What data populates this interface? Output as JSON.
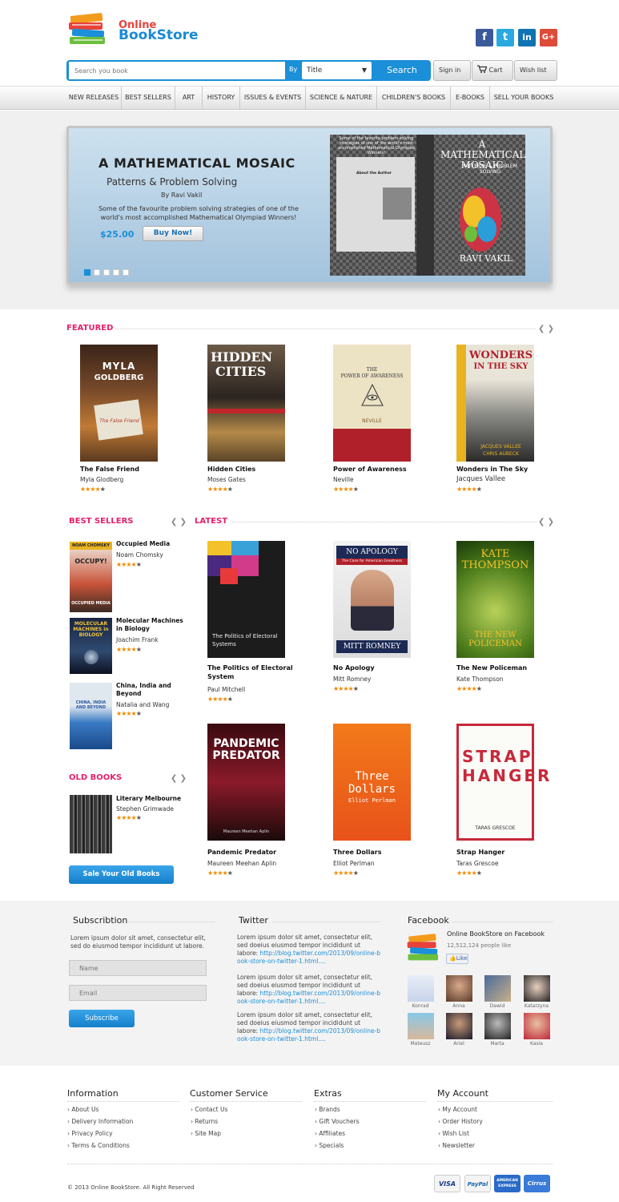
{
  "header": {
    "logo_top": "Online",
    "logo_bottom": "BookStore",
    "social": [
      "f",
      "t",
      "in",
      "G+"
    ],
    "search": {
      "placeholder": "Search you book",
      "by": "By",
      "select": "Title",
      "button": "Search"
    },
    "account": {
      "sign_in": "Sign in",
      "cart": "Cart",
      "wish_list": "Wish list"
    }
  },
  "nav": [
    "NEW RELEASES",
    "BEST SELLERS",
    "ART",
    "HISTORY",
    "ISSUES & EVENTS",
    "SCIENCE & NATURE",
    "CHILDREN'S BOOKS",
    "E-BOOKS",
    "SELL YOUR BOOKS"
  ],
  "hero": {
    "title": "A MATHEMATICAL MOSAIC",
    "subtitle": "Patterns & Problem Solving",
    "by": "By Ravi Vakil",
    "desc": "Some of the favourite problem solving strategies of one of the world's most accomplished Mathematical Olympiad Winners!",
    "price": "$25.00",
    "button": "Buy Now!",
    "cover_title": "A MATHEMATICAL MOSAIC",
    "cover_sub": "PATTERNS & PROBLEM SOLVING",
    "cover_author": "RAVI VAKIL",
    "cover_back": "Some of the favorite problem solving strategies of one of the world's most accomplished Mathematical Olympiad Winners!",
    "cover_about": "About the Author"
  },
  "featured": {
    "title": "FEATURED",
    "books": [
      {
        "title": "The False Friend",
        "author": "Myla Glodberg",
        "rating": 4,
        "cover_top": "MYLA",
        "cover_mid": "GOLDBERG",
        "cover_note": "The False Friend"
      },
      {
        "title": "Hidden Cities",
        "author": "Moses Gates",
        "rating": 4,
        "cover_top": "HIDDEN",
        "cover_mid": "CITIES"
      },
      {
        "title": "Power of Awareness",
        "author": "Neville",
        "rating": 4,
        "cover_top": "THE",
        "cover_mid": "POWER OF AWARENESS",
        "cover_note": "NEVILLE"
      },
      {
        "title": "Wonders in The Sky",
        "author": "Jacques Vallee",
        "rating": 4,
        "cover_top": "WONDERS",
        "cover_mid": "IN THE SKY",
        "cover_note": "JACQUES VALLEE",
        "cover_note2": "CHRIS AUBECK"
      }
    ]
  },
  "best_sellers": {
    "title": "BEST SELLERS",
    "books": [
      {
        "title": "Occupied Media",
        "author": "Noam Chomsky",
        "rating": 4,
        "cover_top": "NOAM CHOMSKY",
        "cover_mid": "OCCUPY!",
        "cover_note": "OCCUPIED MEDIA"
      },
      {
        "title": "Molecular Machines in Biology",
        "author": "Joachim Frank",
        "rating": 4,
        "cover_top": "MOLECULAR MACHINES in BIOLOGY"
      },
      {
        "title": "China, India and Beyond",
        "author": "Natalia and Wang",
        "rating": 4,
        "cover_top": "CHINA, INDIA AND BEYOND"
      }
    ]
  },
  "latest": {
    "title": "LATEST",
    "books": [
      {
        "title": "The Politics of Electoral System",
        "author": "Paul Mitchell",
        "rating": 4,
        "cover_top": "The Politics of Electoral Systems"
      },
      {
        "title": "No Apology",
        "author": "Mitt Romney",
        "rating": 4,
        "cover_top": "NO APOLOGY",
        "cover_sub": "The Case for American Greatness",
        "cover_note": "MITT ROMNEY"
      },
      {
        "title": "The New Policeman",
        "author": "Kate Thompson",
        "rating": 4,
        "cover_top": "KATE THOMPSON",
        "cover_mid": "THE NEW POLICEMAN"
      },
      {
        "title": "Pandemic Predator",
        "author": "Maureen Meehan Aplin",
        "rating": 4,
        "cover_top": "PANDEMIC PREDATOR",
        "cover_note": "Maureen Meehan Aplin"
      },
      {
        "title": "Three Dollars",
        "author": "Elliot Perlman",
        "rating": 4,
        "cover_top": "Three Dollars",
        "cover_note": "Elliot Perlman"
      },
      {
        "title": "Strap Hanger",
        "author": "Taras Grescoe",
        "rating": 4,
        "cover_top": "STRAP HANGER",
        "cover_note": "TARAS GRESCOE"
      }
    ]
  },
  "old_books": {
    "title": "OLD BOOKS",
    "books": [
      {
        "title": "Literary Melbourne",
        "author": "Stephen Grimwade",
        "rating": 4
      }
    ],
    "sell_button": "Sale Your Old Books"
  },
  "subscription": {
    "title": "Subscribtion",
    "text": "Lorem ipsum dolor sit amet, consectetur  elit, sed do eiusmod tempor incididunt ut labore.",
    "name_placeholder": "Name",
    "email_placeholder": "Email",
    "button": "Subscribe"
  },
  "twitter": {
    "title": "Twitter",
    "tweets": [
      {
        "text": "Lorem ipsum dolor sit amet, consectetur  elit, sed doeius eiusmod tempor incididunt ut labore:",
        "link": "http://blog.twitter.com/2013/09/online-book-store-on-twitter-1.html...."
      },
      {
        "text": "Lorem ipsum dolor sit amet, consectetur  elit, sed doeius eiusmod tempor incididunt ut labore:",
        "link": "http://blog.twitter.com/2013/09/online-book-store-on-twitter-1.html...."
      },
      {
        "text": "Lorem ipsum dolor sit amet, consectetur  elit, sed doeius eiusmod tempor incididunt ut labore:",
        "link": "http://blog.twitter.com/2013/09/online-book-store-on-twitter-1.html...."
      }
    ]
  },
  "facebook": {
    "title": "Facebook",
    "page": "Online BookStore on Facebook",
    "likes": "12,512,124 people like",
    "like_button": "Like",
    "fans": [
      "Konrad",
      "Anna",
      "Dawid",
      "Katarzyna",
      "Mateusz",
      "Ariel",
      "Marta",
      "Kasia"
    ]
  },
  "footer": {
    "columns": [
      {
        "title": "Information",
        "links": [
          "About Us",
          "Delivery Information",
          "Privacy Policy",
          "Terms & Conditions"
        ]
      },
      {
        "title": "Customer Service",
        "links": [
          "Contact Us",
          "Returns",
          "Site Map"
        ]
      },
      {
        "title": "Extras",
        "links": [
          "Brands",
          "Gift Vouchers",
          "Affiliates",
          "Specials"
        ]
      },
      {
        "title": "My Account",
        "links": [
          "My Account",
          "Order History",
          "Wish List",
          "Newsletter"
        ]
      }
    ],
    "copyright": "© 2013 Online BookStore. All Right Reserved",
    "payments": [
      "VISA",
      "PayPal",
      "AMERICAN EXPRESS",
      "Cirrus"
    ]
  }
}
